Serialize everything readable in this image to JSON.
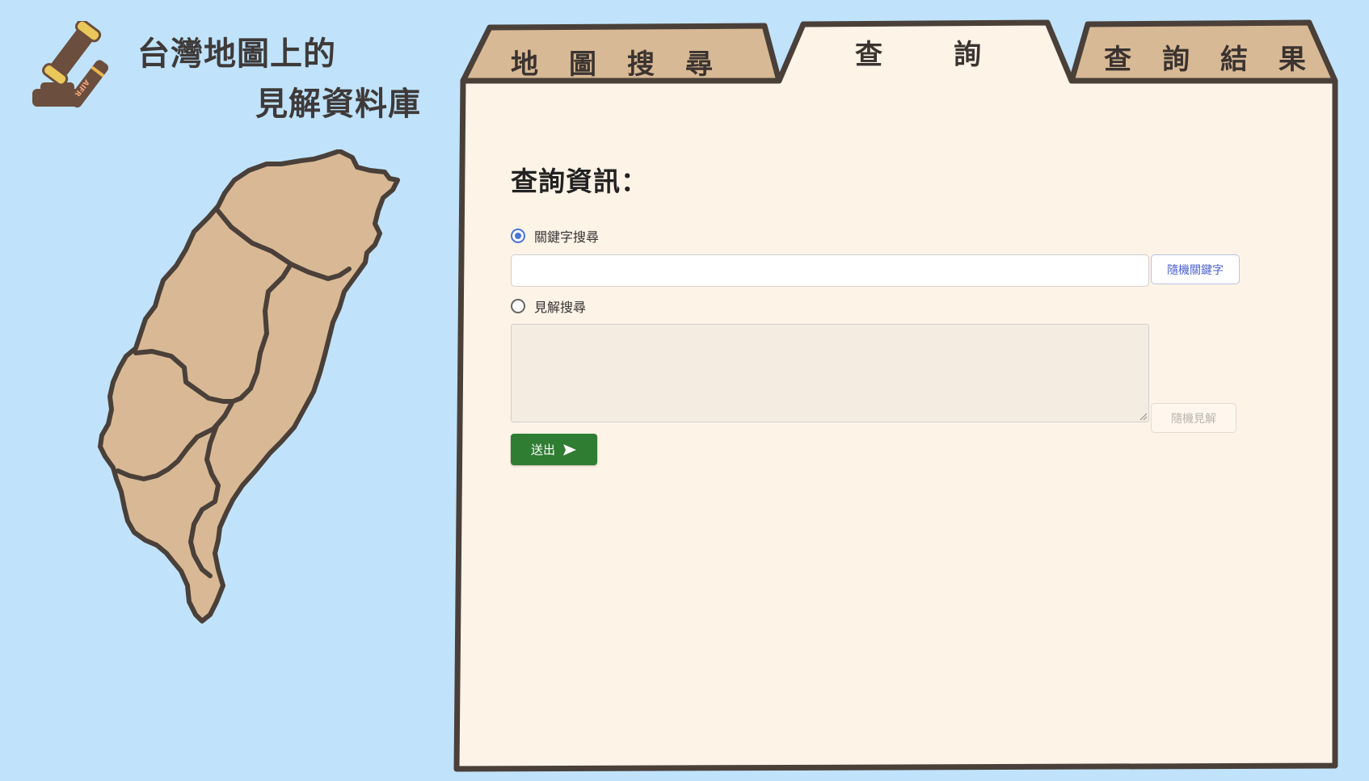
{
  "header": {
    "title_line1": "台灣地圖上的",
    "title_line2": "見解資料庫",
    "logo_badge": "AIFR",
    "logo_icon": "gavel-icon"
  },
  "tabs": [
    {
      "label": "地圖搜尋",
      "active": false
    },
    {
      "label": "查詢",
      "active": true
    },
    {
      "label": "查詢結果",
      "active": false
    }
  ],
  "form": {
    "title": "查詢資訊：",
    "keyword_option": {
      "label": "關鍵字搜尋",
      "checked": true
    },
    "keyword_input": {
      "value": "",
      "placeholder": ""
    },
    "random_keyword_button": "隨機關鍵字",
    "opinion_option": {
      "label": "見解搜尋",
      "checked": false
    },
    "opinion_textarea": {
      "value": "",
      "placeholder": ""
    },
    "random_opinion_button": "隨機見解",
    "submit_button": "送出",
    "submit_icon": "send-icon"
  },
  "colors": {
    "background": "#c0e3fb",
    "map_fill": "#d9b995",
    "outline": "#4a4039",
    "inactive_tab": "#d8b995",
    "panel": "#fef3e7",
    "accent_blue": "#4a73d9",
    "submit_green": "#2f7d32"
  }
}
